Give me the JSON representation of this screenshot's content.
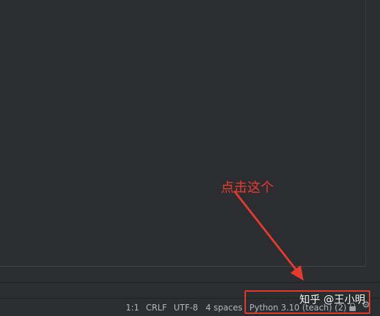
{
  "statusbar": {
    "caret_position": "1:1",
    "line_separator": "CRLF",
    "encoding": "UTF-8",
    "indent": "4 spaces",
    "interpreter": "Python 3.10 (teach) (2)",
    "lock_icon": "lock-icon",
    "extra_icon": "settings-icon"
  },
  "annotation": {
    "text": "点击这个",
    "color": "#e53a2e"
  },
  "watermark": {
    "text": "知乎 @王小明"
  }
}
